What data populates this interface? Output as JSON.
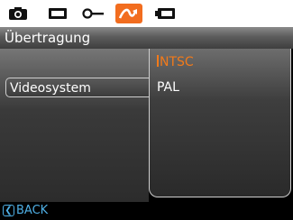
{
  "tabs": [
    {
      "icon": "camera-icon",
      "active": false
    },
    {
      "icon": "display-icon",
      "active": false
    },
    {
      "icon": "key-icon",
      "active": false
    },
    {
      "icon": "transfer-icon",
      "active": true
    },
    {
      "icon": "battery-icon",
      "active": false
    }
  ],
  "title": "Übertragung",
  "menu": {
    "selected_item": "Videosystem"
  },
  "submenu": {
    "options": [
      "NTSC",
      "PAL"
    ],
    "selected": "NTSC"
  },
  "back": {
    "icon": "back-arrow-icon",
    "label": "BACK"
  },
  "colors": {
    "accent": "#f26d1f",
    "back": "#4fb0e6"
  }
}
